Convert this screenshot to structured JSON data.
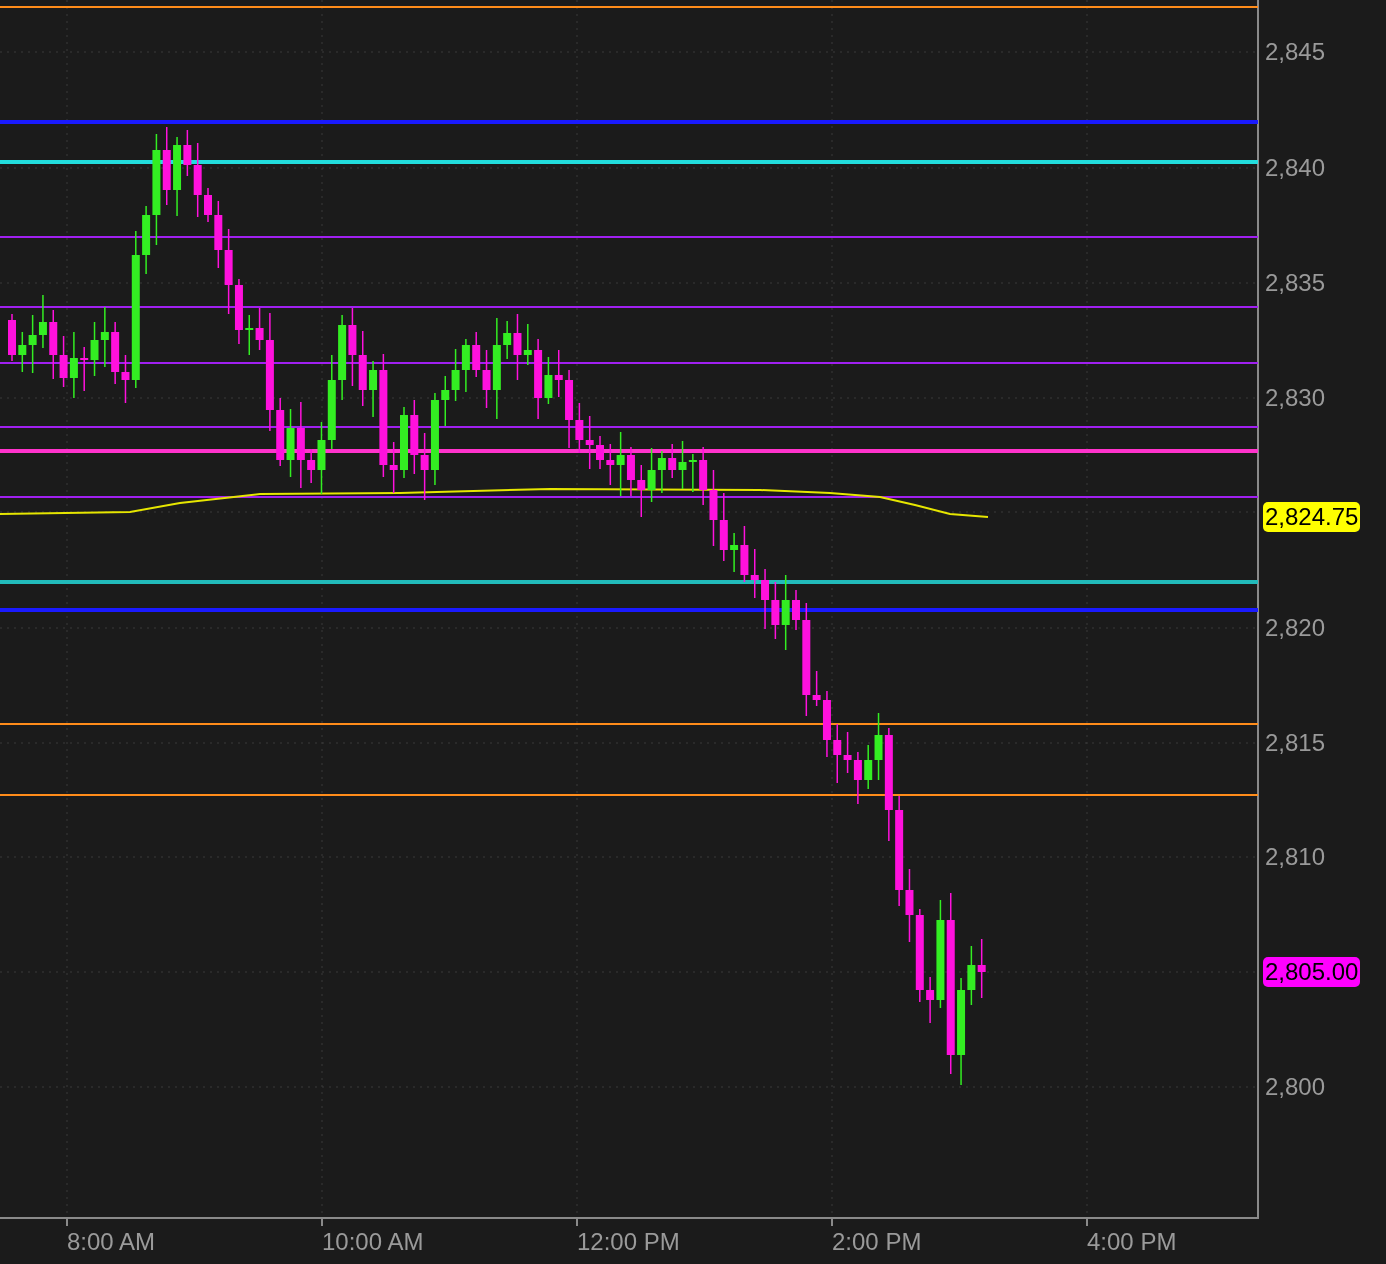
{
  "price_axis": {
    "ticks": [
      "2,845",
      "2,840",
      "2,835",
      "2,830",
      "2,820",
      "2,815",
      "2,810",
      "2,800"
    ],
    "badges": [
      {
        "text": "2,824.75",
        "color": "#ffff00"
      },
      {
        "text": "2,805.00",
        "color": "#ff00ff"
      }
    ]
  },
  "time_axis": {
    "ticks": [
      "8:00 AM",
      "10:00 AM",
      "12:00 PM",
      "2:00 PM",
      "4:00 PM"
    ]
  }
}
